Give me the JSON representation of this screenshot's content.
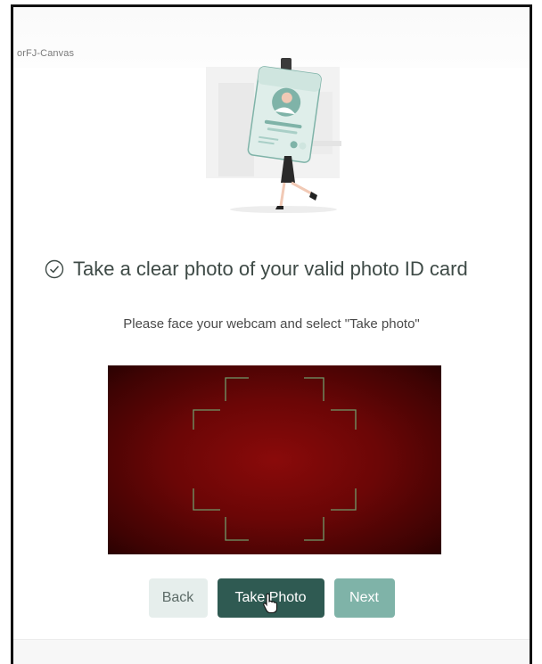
{
  "app": {
    "name": "orFJ-Canvas"
  },
  "instruction": {
    "title": "Take a clear photo of your valid photo ID card",
    "subtitle": "Please face your webcam and select \"Take photo\""
  },
  "buttons": {
    "back_label": "Back",
    "take_photo_label": "Take Photo",
    "next_label": "Next"
  },
  "icons": {
    "check": "check-circle-icon",
    "cursor": "hand-pointer-icon"
  },
  "colors": {
    "primary": "#2f5a52",
    "next": "#7fb3a8",
    "back_bg": "#e6eeec",
    "webcam_bg": "#6b0606",
    "frame_guides": "#6f9a6a"
  }
}
